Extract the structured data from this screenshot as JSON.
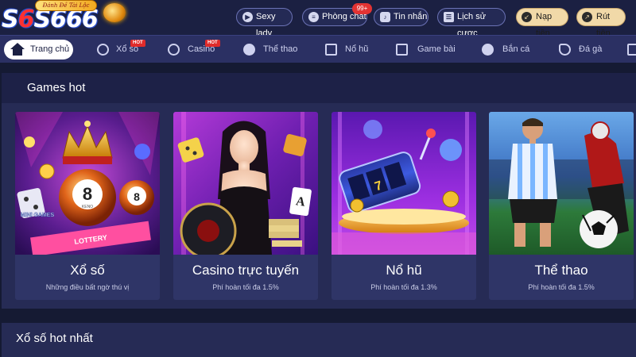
{
  "header": {
    "logo_prefix": "S",
    "logo_highlight": "6",
    "logo_suffix": "S666",
    "logo_banner": "Đánh Đề Tài Lộc",
    "buttons": [
      {
        "label": "Sexy lady",
        "icon": "play-icon"
      },
      {
        "label": "Phòng chat",
        "icon": "chat-icon",
        "badge": "99+"
      },
      {
        "label": "Tin nhắn",
        "icon": "bell-icon"
      },
      {
        "label": "Lịch sử cược",
        "icon": "history-icon"
      }
    ],
    "deposit_label": "Nạp tiền",
    "withdraw_label": "Rút tiền"
  },
  "nav": {
    "home_label": "Trang chủ",
    "items": [
      {
        "label": "Xổ số",
        "hot": "HOT",
        "icon": "lottery-icon"
      },
      {
        "label": "Casino",
        "hot": "HOT",
        "icon": "casino-icon"
      },
      {
        "label": "Thể thao",
        "icon": "soccer-ball-icon"
      },
      {
        "label": "Nổ hũ",
        "icon": "slot-icon"
      },
      {
        "label": "Game bài",
        "icon": "cards-icon"
      },
      {
        "label": "Bắn cá",
        "icon": "fish-icon"
      },
      {
        "label": "Đá gà",
        "icon": "rooster-icon"
      }
    ]
  },
  "games_hot": {
    "title": "Games hot",
    "cards": [
      {
        "title": "Xổ số",
        "subtitle": "Những điều bất ngờ thú vị",
        "ball_1": "8",
        "ball_2": "8",
        "ball_caption": "KENO",
        "tag": "MINI GAMES",
        "ticket": "LOTTERY"
      },
      {
        "title": "Casino trực tuyến",
        "subtitle": "Phí hoàn tối đa 1.5%",
        "card_rank": "A"
      },
      {
        "title": "Nổ hũ",
        "subtitle": "Phí hoàn tối đa 1.3%",
        "reel_symbol": "7"
      },
      {
        "title": "Thể thao",
        "subtitle": "Phí hoàn tối đa 1.5%"
      }
    ]
  },
  "section2": {
    "title": "Xổ số hot nhất"
  },
  "colors": {
    "background": "#151a33",
    "topbar": "#1b2042",
    "nav": "#2b3063",
    "panel": "#262b55",
    "card": "#2f3567",
    "hot_badge": "#e02b2b",
    "gold_button": "#f1d9a8"
  }
}
